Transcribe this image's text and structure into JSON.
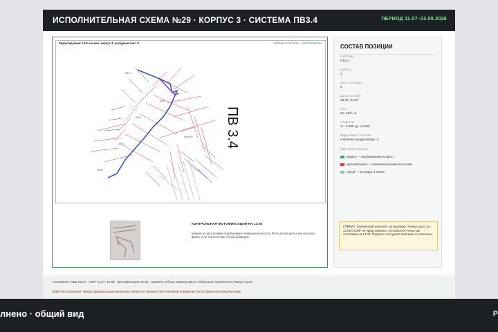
{
  "header": {
    "title": "ИСПОЛНИТЕЛЬНАЯ СХЕМА №29 · КОРПУС 3 · СИСТЕМА ПВ3.4",
    "period": "ПЕРИОД 11.07–13.08.2026"
  },
  "drawing": {
    "caption": "Редактируемая CAD-основа: корпус 3, исходный лист 8",
    "caption_right": "СЕРЫЕ УЧАСТКИ — ИСКЛЮЧЕНЫ",
    "system_mark": "ПВ 3.4"
  },
  "photo": {
    "title": "КОНТРОЛЬНАЯ ФОТОФИКСАЦИЯ НА 13.08",
    "text": "Маркер на фотографии подтверждает выбранный участок. Фото используется как контроль факта, а не как источник точных размеров."
  },
  "sidebar": {
    "title": "СОСТАВ ПОЗИЦИИ",
    "fields": [
      {
        "label": "СИСТЕМА",
        "value": "ПВ3.4"
      },
      {
        "label": "КОРПУС",
        "value": "3"
      },
      {
        "label": "ЛИСТ ОСНОВЫ",
        "value": "8"
      },
      {
        "label": "ДАТЫ ПО ОЖР",
        "value": "23.07, 24.07"
      },
      {
        "label": "ОСИ",
        "value": "21–26/А–К"
      },
      {
        "label": "ОТМЕТКИ",
        "value": "от -3.900 до +0.000"
      },
      {
        "label": "ВИДЫ РАБОТ ПО ОЖР",
        "value": "• Монтаж воздуховода: 2"
      }
    ],
    "legend_title": "ЦВЕТОВАЯ ЛОГИКА",
    "legend": [
      {
        "color": "#2fb35a",
        "text": "маркер — подтверждение на фото"
      },
      {
        "color": "#e53935",
        "text": "красный/синий — сохраняемая разметка основы"
      },
      {
        "color": "#b0b0b0",
        "text": "серый — не входит в объём"
      }
    ]
  },
  "status": {
    "label": "СТАТУС:",
    "text": "технический комплект на проверку. Точные даты 11–13.08 в ОЖР не представлены; эти работы учтены как состояние на 13.08. Подпись и натурная приёмка не включены."
  },
  "footer": {
    "basis": "Основание: ОВ2 изм.6 · ОЖР 11.07–10.08 · фотофиксация 13.08 · правило отбора: маркер минус небольшое выполнение минус серое.",
    "warning": "Файл без подписей. Перед официальным выпуском требуется сверка ответственным специалистом по фактическому монтажу."
  },
  "bottom_bar": {
    "left": "лнено · общий вид",
    "right": "Р"
  },
  "colors": {
    "accent_green": "#2f9a56",
    "header_bg": "#1c1f24",
    "red_lines": "#e53935",
    "blue_lines": "#3b4fc4"
  }
}
